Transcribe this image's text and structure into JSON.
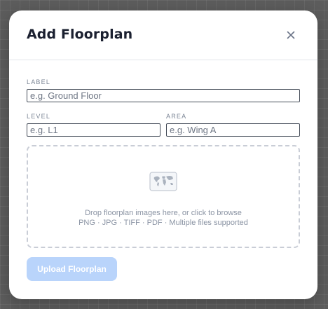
{
  "modal": {
    "title": "Add Floorplan",
    "close_icon": "close-icon"
  },
  "form": {
    "label_field": {
      "label": "LABEL",
      "placeholder": "e.g. Ground Floor",
      "value": ""
    },
    "level_field": {
      "label": "LEVEL",
      "placeholder": "e.g. L1",
      "value": ""
    },
    "area_field": {
      "label": "AREA",
      "placeholder": "e.g. Wing A",
      "value": ""
    }
  },
  "dropzone": {
    "icon": "world-map-icon",
    "primary_text": "Drop floorplan images here, or click to browse",
    "secondary_text": "PNG · JPG · TIFF · PDF · Multiple files supported"
  },
  "actions": {
    "upload_label": "Upload Floorplan"
  },
  "colors": {
    "upload_button_bg": "#b9d4fb",
    "title_text": "#1b2030",
    "backdrop": "#5d5d5d"
  }
}
